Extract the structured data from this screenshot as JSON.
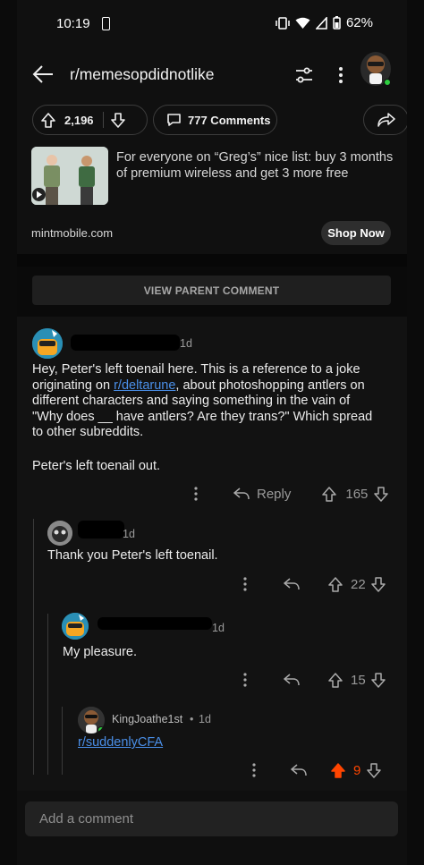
{
  "status_bar": {
    "time": "10:19",
    "battery": "62%"
  },
  "header": {
    "subreddit": "r/memesopdidnotlike"
  },
  "post_actions": {
    "upvotes": "2,196",
    "comments": "777 Comments"
  },
  "ad": {
    "text": "For everyone on “Greg’s” nice list: buy 3 months of premium wireless and get 3 more free",
    "domain": "mintmobile.com",
    "cta": "Shop Now"
  },
  "view_parent": "VIEW PARENT COMMENT",
  "comments": [
    {
      "age": "1d",
      "body_pre": "Hey, Peter's left toenail here. This is a reference to a joke originating on ",
      "body_link": "r/deltarune",
      "body_post": ", about photoshopping antlers on different characters and saying something in the vain of \"Why does __ have antlers? Are they trans?\" Which spread to other subreddits.",
      "body2": "Peter's left toenail out.",
      "reply_label": "Reply",
      "score": "165"
    },
    {
      "age": "1d",
      "body": "Thank you Peter's left toenail.",
      "score": "22"
    },
    {
      "age": "1d",
      "body": "My pleasure.",
      "score": "15"
    },
    {
      "user": "KingJoathe1st",
      "age": "1d",
      "link": "r/suddenlyCFA",
      "score": "9"
    }
  ],
  "add_comment": {
    "placeholder": "Add a comment"
  },
  "colors": {
    "upvote_active": "#ff4500",
    "link": "#4a8fe8"
  }
}
